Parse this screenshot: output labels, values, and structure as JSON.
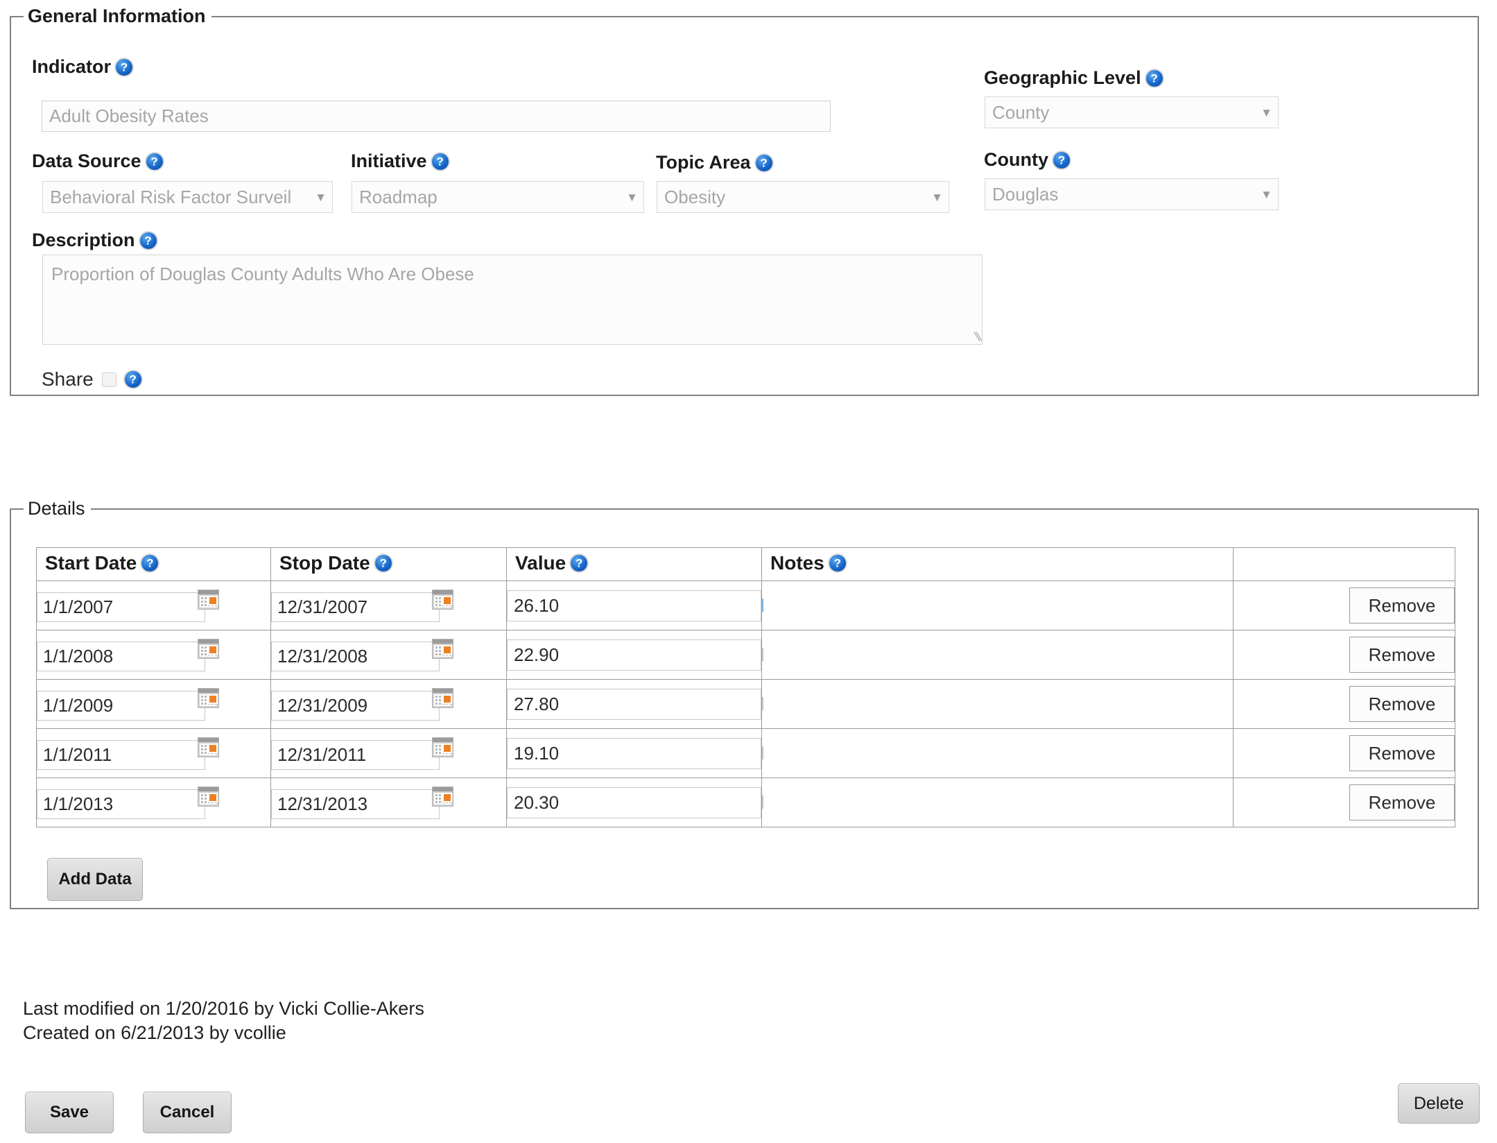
{
  "general": {
    "legend": "General Information",
    "indicator": {
      "label": "Indicator",
      "value": "Adult Obesity Rates",
      "help": "help-icon"
    },
    "data_source": {
      "label": "Data Source",
      "value": "Behavioral Risk Factor Surveil",
      "caret": "▼"
    },
    "initiative": {
      "label": "Initiative",
      "value": "Roadmap",
      "caret": "▼"
    },
    "topic_area": {
      "label": "Topic Area",
      "value": "Obesity",
      "caret": "▼"
    },
    "geographic_level": {
      "label": "Geographic Level",
      "value": "County",
      "caret": "▼"
    },
    "county": {
      "label": "County",
      "value": "Douglas",
      "caret": "▼"
    },
    "description": {
      "label": "Description",
      "value": "Proportion of Douglas County Adults Who Are Obese",
      "grip": "⁄⁄"
    },
    "share": {
      "label": "Share",
      "checked": false
    }
  },
  "details": {
    "legend": "Details",
    "columns": [
      "Start Date",
      "Stop Date",
      "Value",
      "Notes",
      ""
    ],
    "rows": [
      {
        "start": "1/1/2007",
        "stop": "12/31/2007",
        "value": "26.10",
        "notes": "",
        "notes_focused": true,
        "remove": "Remove"
      },
      {
        "start": "1/1/2008",
        "stop": "12/31/2008",
        "value": "22.90",
        "notes": "",
        "notes_focused": false,
        "remove": "Remove"
      },
      {
        "start": "1/1/2009",
        "stop": "12/31/2009",
        "value": "27.80",
        "notes": "",
        "notes_focused": false,
        "remove": "Remove"
      },
      {
        "start": "1/1/2011",
        "stop": "12/31/2011",
        "value": "19.10",
        "notes": "",
        "notes_focused": false,
        "remove": "Remove"
      },
      {
        "start": "1/1/2013",
        "stop": "12/31/2013",
        "value": "20.30",
        "notes": "",
        "notes_focused": false,
        "remove": "Remove"
      }
    ],
    "add_data_label": "Add Data"
  },
  "footer": {
    "last_modified": "Last modified on 1/20/2016  by Vicki Collie-Akers",
    "created": "Created on 6/21/2013  by vcollie",
    "save_label": "Save",
    "cancel_label": "Cancel",
    "delete_label": "Delete"
  },
  "colors": {
    "help_icon_blue": "#1565c8",
    "calendar_accent_orange": "#ef8022",
    "focus_border_blue": "#7db7e8",
    "fieldset_border": "#808080",
    "placeholder_text": "#a6a6a6"
  }
}
